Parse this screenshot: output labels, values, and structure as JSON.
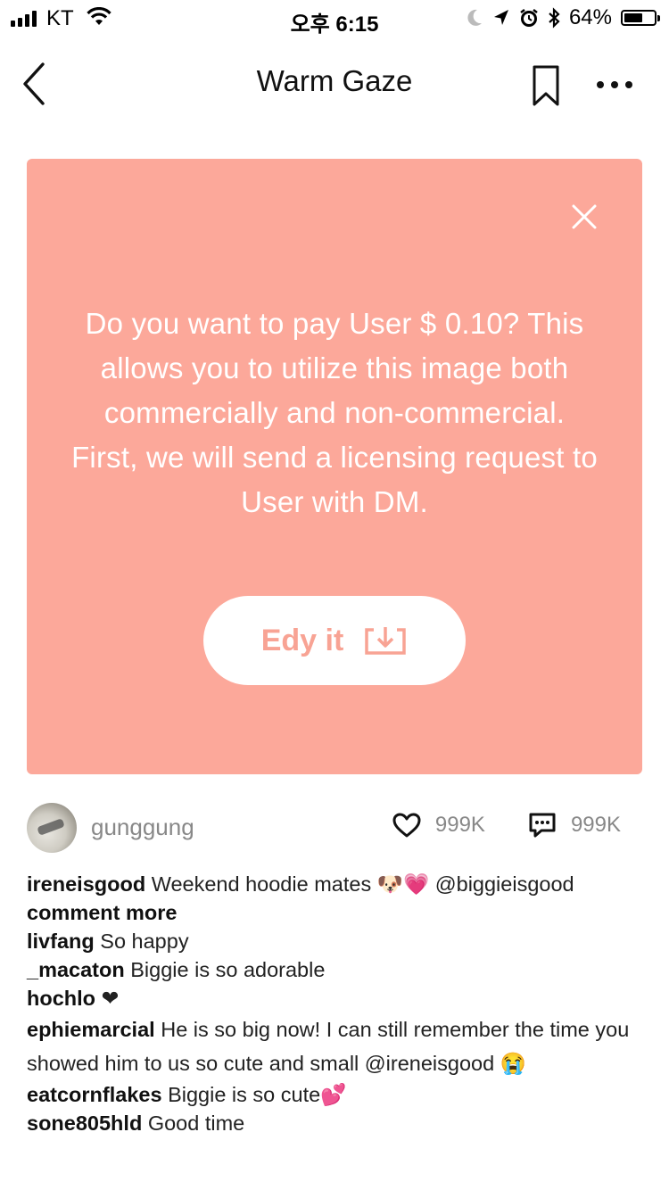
{
  "status": {
    "carrier": "KT",
    "time": "오후 6:15",
    "battery": "64%",
    "battery_level": 0.64
  },
  "header": {
    "title": "Warm Gaze"
  },
  "card": {
    "background": "#fca89a",
    "message": "Do you want to pay User $ 0.10? This allows you to utilize this image both commercially and non-commercial. First, we will send a licensing request to User with DM.",
    "button_label": "Edy it"
  },
  "post": {
    "author": "gunggung",
    "likes": "999K",
    "comments": "999K"
  },
  "comments": [
    {
      "user": "ireneisgood",
      "text": "Weekend hoodie mates 🐶💗 @biggieisgood"
    },
    {
      "user": "livfang",
      "text": "So happy"
    },
    {
      "user": "_macaton",
      "text": "Biggie is so adorable"
    },
    {
      "user": "hochlo",
      "text": "❤"
    },
    {
      "user": "ephiemarcial",
      "text": "He is so big now! I can still remember the time you showed him to us so cute and small @ireneisgood 😭"
    },
    {
      "user": "eatcornflakes",
      "text": "Biggie is so cute💕"
    },
    {
      "user": "sone805hld",
      "text": "Good time"
    }
  ],
  "comment_more_label": "comment more",
  "icons": [
    "wifi-icon",
    "moon-icon",
    "location-icon",
    "alarm-icon",
    "bluetooth-icon",
    "back-chevron-icon",
    "bookmark-icon",
    "more-icon",
    "close-icon",
    "download-icon",
    "heart-icon",
    "comment-icon"
  ]
}
